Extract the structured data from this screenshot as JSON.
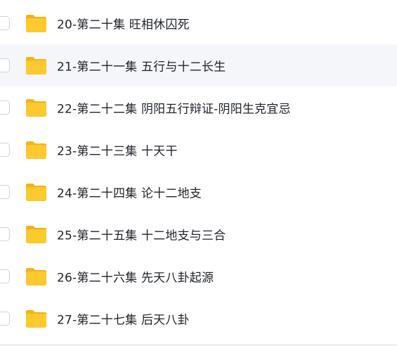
{
  "files": [
    {
      "name": "20-第二十集 旺相休囚死",
      "type_icon": "folder-icon"
    },
    {
      "name": "21-第二十一集 五行与十二长生",
      "type_icon": "folder-icon"
    },
    {
      "name": "22-第二十二集 阴阳五行辩证-阴阳生克宜忌",
      "type_icon": "folder-icon"
    },
    {
      "name": "23-第二十三集 十天干",
      "type_icon": "folder-icon"
    },
    {
      "name": "24-第二十四集 论十二地支",
      "type_icon": "folder-icon"
    },
    {
      "name": "25-第二十五集 十二地支与三合",
      "type_icon": "folder-icon"
    },
    {
      "name": "26-第二十六集 先天八卦起源",
      "type_icon": "folder-icon"
    },
    {
      "name": "27-第二十七集 后天八卦",
      "type_icon": "folder-icon"
    }
  ],
  "colors": {
    "folder_body": "#fcc92f",
    "folder_tab": "#f5b21a",
    "hover_row": "#f5f6fa",
    "text": "#1f2329"
  }
}
